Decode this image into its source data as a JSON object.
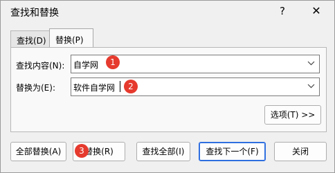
{
  "window": {
    "title": "查找和替换",
    "help_icon": "?",
    "close_icon": "✕"
  },
  "tabs": [
    {
      "label": "查找(D)",
      "active": false
    },
    {
      "label": "替换(P)",
      "active": true
    }
  ],
  "find": {
    "label": "查找内容(N):",
    "value": "自学网"
  },
  "replace": {
    "label": "替换为(E):",
    "value": "软件自学网"
  },
  "buttons": {
    "options": "选项(T) >>",
    "replace_all": "全部替换(A)",
    "replace": "替换(R)",
    "find_all": "查找全部(I)",
    "find_next": "查找下一个(F)",
    "close": "关闭"
  },
  "annotations": [
    "1",
    "2",
    "3"
  ],
  "colors": {
    "badge": "#e63a2e",
    "default_button_border": "#2f6fe0"
  }
}
